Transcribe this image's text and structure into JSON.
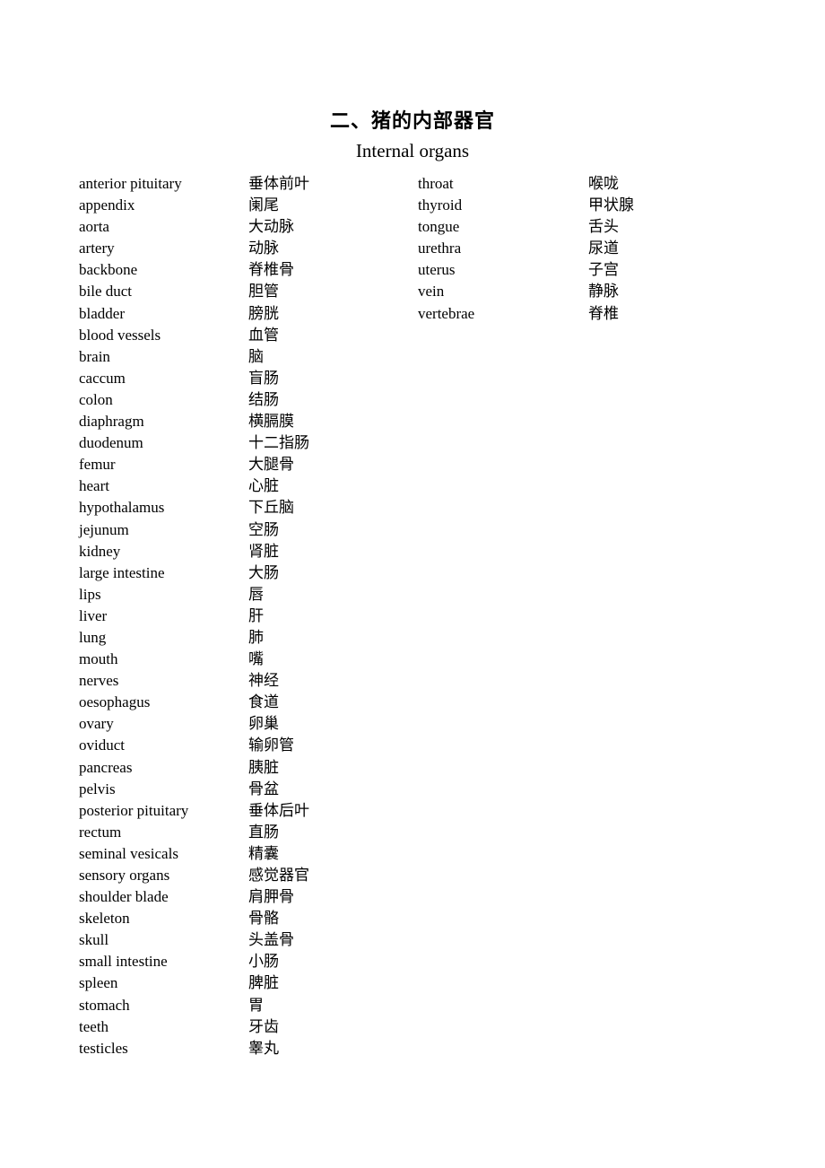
{
  "document": {
    "title_cn": "二、猪的内部器官",
    "title_en": "Internal organs"
  },
  "left_column": [
    {
      "en": "anterior pituitary",
      "cn": "垂体前叶"
    },
    {
      "en": "appendix",
      "cn": "阑尾"
    },
    {
      "en": "aorta",
      "cn": "大动脉"
    },
    {
      "en": "artery",
      "cn": "动脉"
    },
    {
      "en": "backbone",
      "cn": "脊椎骨"
    },
    {
      "en": "bile duct",
      "cn": "胆管"
    },
    {
      "en": "bladder",
      "cn": "膀胱"
    },
    {
      "en": "blood vessels",
      "cn": "血管"
    },
    {
      "en": "brain",
      "cn": "脑"
    },
    {
      "en": "caccum",
      "cn": "盲肠"
    },
    {
      "en": "colon",
      "cn": "结肠"
    },
    {
      "en": "diaphragm",
      "cn": "横膈膜"
    },
    {
      "en": "duodenum",
      "cn": "十二指肠"
    },
    {
      "en": "femur",
      "cn": "大腿骨"
    },
    {
      "en": "heart",
      "cn": "心脏"
    },
    {
      "en": "hypothalamus",
      "cn": "下丘脑"
    },
    {
      "en": "jejunum",
      "cn": "空肠"
    },
    {
      "en": "kidney",
      "cn": "肾脏"
    },
    {
      "en": "large intestine",
      "cn": "大肠"
    },
    {
      "en": "lips",
      "cn": "唇"
    },
    {
      "en": "liver",
      "cn": "肝"
    },
    {
      "en": "lung",
      "cn": "肺"
    },
    {
      "en": "mouth",
      "cn": "嘴"
    },
    {
      "en": "nerves",
      "cn": "神经"
    },
    {
      "en": "oesophagus",
      "cn": "食道"
    },
    {
      "en": "ovary",
      "cn": "卵巢"
    },
    {
      "en": "oviduct",
      "cn": "输卵管"
    },
    {
      "en": "pancreas",
      "cn": "胰脏"
    },
    {
      "en": "pelvis",
      "cn": "骨盆"
    },
    {
      "en": "posterior pituitary",
      "cn": "垂体后叶"
    },
    {
      "en": "rectum",
      "cn": "直肠"
    },
    {
      "en": "seminal vesicals",
      "cn": "精囊"
    },
    {
      "en": "sensory organs",
      "cn": "感觉器官"
    },
    {
      "en": "shoulder blade",
      "cn": "肩胛骨"
    },
    {
      "en": "skeleton",
      "cn": "骨骼"
    },
    {
      "en": "skull",
      "cn": "头盖骨"
    },
    {
      "en": "small intestine",
      "cn": "小肠"
    },
    {
      "en": "spleen",
      "cn": "脾脏"
    },
    {
      "en": "stomach",
      "cn": "胃"
    },
    {
      "en": "teeth",
      "cn": "牙齿"
    },
    {
      "en": "testicles",
      "cn": "睾丸"
    }
  ],
  "right_column": [
    {
      "en": "throat",
      "cn": "喉咙"
    },
    {
      "en": "thyroid",
      "cn": "甲状腺"
    },
    {
      "en": "tongue",
      "cn": "舌头"
    },
    {
      "en": "urethra",
      "cn": "尿道"
    },
    {
      "en": "uterus",
      "cn": "子宫"
    },
    {
      "en": "vein",
      "cn": "静脉"
    },
    {
      "en": "vertebrae",
      "cn": "脊椎"
    }
  ]
}
